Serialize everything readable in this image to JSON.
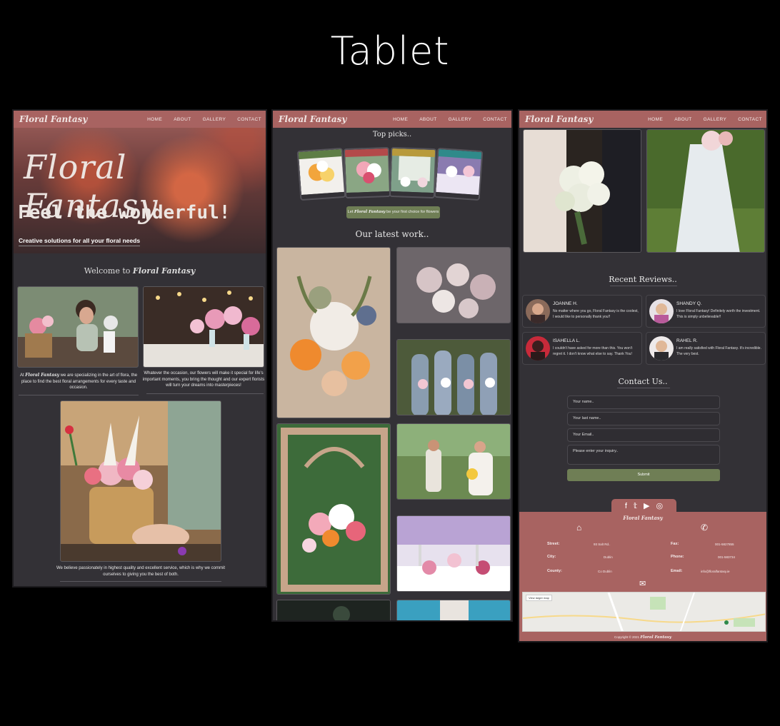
{
  "title": "Tablet",
  "nav": {
    "brand": "Floral Fantasy",
    "links": [
      "HOME",
      "ABOUT",
      "GALLERY",
      "CONTACT"
    ]
  },
  "home": {
    "hero_title": "Floral Fantasy",
    "hero_sub": "Feel the wonderful!",
    "hero_caption": "Creative solutions for all your floral needs",
    "welcome_prefix": "Welcome to",
    "welcome_brand": "Floral Fantasy",
    "text1_prefix": "At",
    "text1_brand": "Floral Fantasy",
    "text1_rest": "we are specializing in the art of flora, the place to find the best floral arrangements for every taste and occasion.",
    "text2": "Whatever the occasion, our flowers will make it special for life's important moments, you bring the thought and our expert florists will turn your dreams into masterpieces!",
    "text3": "We believe passionately in highest quality and excellent service, which is why we commit ourselves to giving you the best of both."
  },
  "gallery": {
    "top_picks": "Top picks..",
    "pill_prefix": "Let",
    "pill_brand": "Floral Fantasy",
    "pill_rest": "be your first choice for flowers",
    "latest_work": "Our latest work.."
  },
  "contact": {
    "reviews_title": "Recent Reviews..",
    "reviews": [
      {
        "name": "JOANNE H.",
        "text": "No matter where you go, Floral Fantasy is the coolest, I would like to personally thank you!!"
      },
      {
        "name": "SHANDY Q.",
        "text": "I love Floral Fantasy! Definitely worth the investment. This is simply unbelievable!!"
      },
      {
        "name": "ISAHELLA L.",
        "text": "I couldn't have asked for more than this. You won't regret it. I don't know what else to say. Thank You!"
      },
      {
        "name": "RAHEL R.",
        "text": "I am really satisfied with Floral Fantasy. It's incredible. The very best."
      }
    ],
    "contact_title": "Contact Us..",
    "form": {
      "name": "Your name..",
      "last_name": "Your last name..",
      "email": "Your Email..",
      "inquiry": "Please enter your inquiry..",
      "submit": "Submit"
    },
    "footer": {
      "brand": "Floral Fantasy",
      "street_label": "Street:",
      "street_value": "93 Salt Rd..",
      "city_label": "City:",
      "city_value": "Dublin",
      "county_label": "County:",
      "county_value": "Co Dublin",
      "fax_label": "Fax:",
      "fax_value": "001-5827855",
      "phone_label": "Phone:",
      "phone_value": "001-583734",
      "email_label": "Email:",
      "email_value": "info@floralfantasy.ie",
      "map_button": "View larger map",
      "copyright_prefix": "Copyright © 2021",
      "copyright_brand": "Floral Fantasy"
    }
  },
  "colors": {
    "nav": "#a86361",
    "panel": "#333136",
    "accent_green": "#6f7e55"
  }
}
